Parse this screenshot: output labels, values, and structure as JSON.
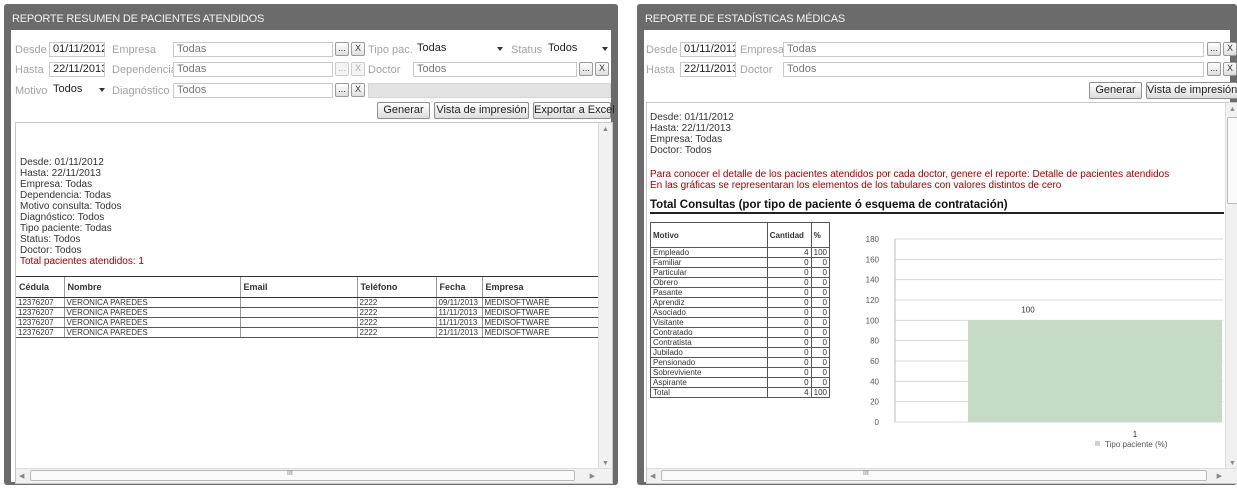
{
  "left": {
    "title": "REPORTE RESUMEN DE PACIENTES ATENDIDOS",
    "filters": {
      "desde_label": "Desde",
      "desde_value": "01/11/2012",
      "hasta_label": "Hasta",
      "hasta_value": "22/11/2013",
      "motivo_label": "Motivo",
      "motivo_value": "Todos",
      "empresa_label": "Empresa",
      "empresa_value": "Todas",
      "dependencia_label": "Dependencia",
      "dependencia_value": "Todas",
      "diagnostico_label": "Diagnóstico",
      "diagnostico_value": "Todos",
      "tipo_label": "Tipo pac.",
      "tipo_value": "Todas",
      "status_label": "Status",
      "status_value": "Todos",
      "doctor_label": "Doctor",
      "doctor_value": "Todos",
      "ellipsis": "...",
      "clear": "X"
    },
    "buttons": {
      "generar": "Generar",
      "vista": "Vista de impresión",
      "exportar": "Exportar a Excel"
    },
    "summary": {
      "desde": "Desde: 01/11/2012",
      "hasta": "Hasta: 22/11/2013",
      "empresa": "Empresa: Todas",
      "dependencia": "Dependencia: Todas",
      "motivo": "Motivo consulta: Todos",
      "diagnostico": "Diagnóstico: Todos",
      "tipo": "Tipo paciente: Todas",
      "status": "Status: Todos",
      "doctor": "Doctor: Todos",
      "total": "Total pacientes atendidos: 1"
    },
    "table": {
      "headers": [
        "Cédula",
        "Nombre",
        "Email",
        "Teléfono",
        "Fecha",
        "Empresa"
      ],
      "rows": [
        [
          "12376207",
          "VERONICA PAREDES",
          "",
          "2222",
          "09/11/2013",
          "MEDISOFTWARE"
        ],
        [
          "12376207",
          "VERONICA PAREDES",
          "",
          "2222",
          "11/11/2013",
          "MEDISOFTWARE"
        ],
        [
          "12376207",
          "VERONICA PAREDES",
          "",
          "2222",
          "11/11/2013",
          "MEDISOFTWARE"
        ],
        [
          "12376207",
          "VERONICA PAREDES",
          "",
          "2222",
          "21/11/2013",
          "MEDISOFTWARE"
        ]
      ]
    },
    "hscroll_grip": "III"
  },
  "right": {
    "title": "REPORTE DE ESTADÍSTICAS MÉDICAS",
    "filters": {
      "desde_label": "Desde",
      "desde_value": "01/11/2012",
      "hasta_label": "Hasta",
      "hasta_value": "22/11/2013",
      "empresa_label": "Empresa",
      "empresa_value": "Todas",
      "doctor_label": "Doctor",
      "doctor_value": "Todos",
      "ellipsis": "...",
      "clear": "X"
    },
    "buttons": {
      "generar": "Generar",
      "vista": "Vista de impresión"
    },
    "summary": {
      "desde": "Desde: 01/11/2012",
      "hasta": "Hasta: 22/11/2013",
      "empresa": "Empresa: Todas",
      "doctor": "Doctor: Todos"
    },
    "notes": {
      "line1": "Para conocer el detalle de los pacientes atendidos por cada doctor, genere el reporte: Detalle de pacientes atendidos",
      "line2": "En las gráficas se representaran los elementos de los tabulares con valores distintos de cero"
    },
    "section_title": "Total Consultas (por tipo de paciente ó esquema de contratación)",
    "table": {
      "headers": [
        "Motivo",
        "Cantidad",
        "%"
      ],
      "rows": [
        [
          "Empleado",
          "4",
          "100"
        ],
        [
          "Familiar",
          "0",
          "0"
        ],
        [
          "Particular",
          "0",
          "0"
        ],
        [
          "Obrero",
          "0",
          "0"
        ],
        [
          "Pasante",
          "0",
          "0"
        ],
        [
          "Aprendiz",
          "0",
          "0"
        ],
        [
          "Asociado",
          "0",
          "0"
        ],
        [
          "Visitante",
          "0",
          "0"
        ],
        [
          "Contratado",
          "0",
          "0"
        ],
        [
          "Contratista",
          "0",
          "0"
        ],
        [
          "Jubilado",
          "0",
          "0"
        ],
        [
          "Pensionado",
          "0",
          "0"
        ],
        [
          "Sobreviviente",
          "0",
          "0"
        ],
        [
          "Aspirante",
          "0",
          "0"
        ],
        [
          "Total",
          "4",
          "100"
        ]
      ]
    },
    "hscroll_grip": "III"
  },
  "chart_data": {
    "type": "bar",
    "categories": [
      "1"
    ],
    "series": [
      {
        "name": "Tipo paciente (%)",
        "values": [
          100
        ]
      }
    ],
    "ylim": [
      0,
      180
    ],
    "yticks": [
      0,
      20,
      40,
      60,
      80,
      100,
      120,
      140,
      160,
      180
    ],
    "data_labels": [
      "100"
    ],
    "bar_color": "#c6dbc6",
    "legend_position": "bottom"
  }
}
